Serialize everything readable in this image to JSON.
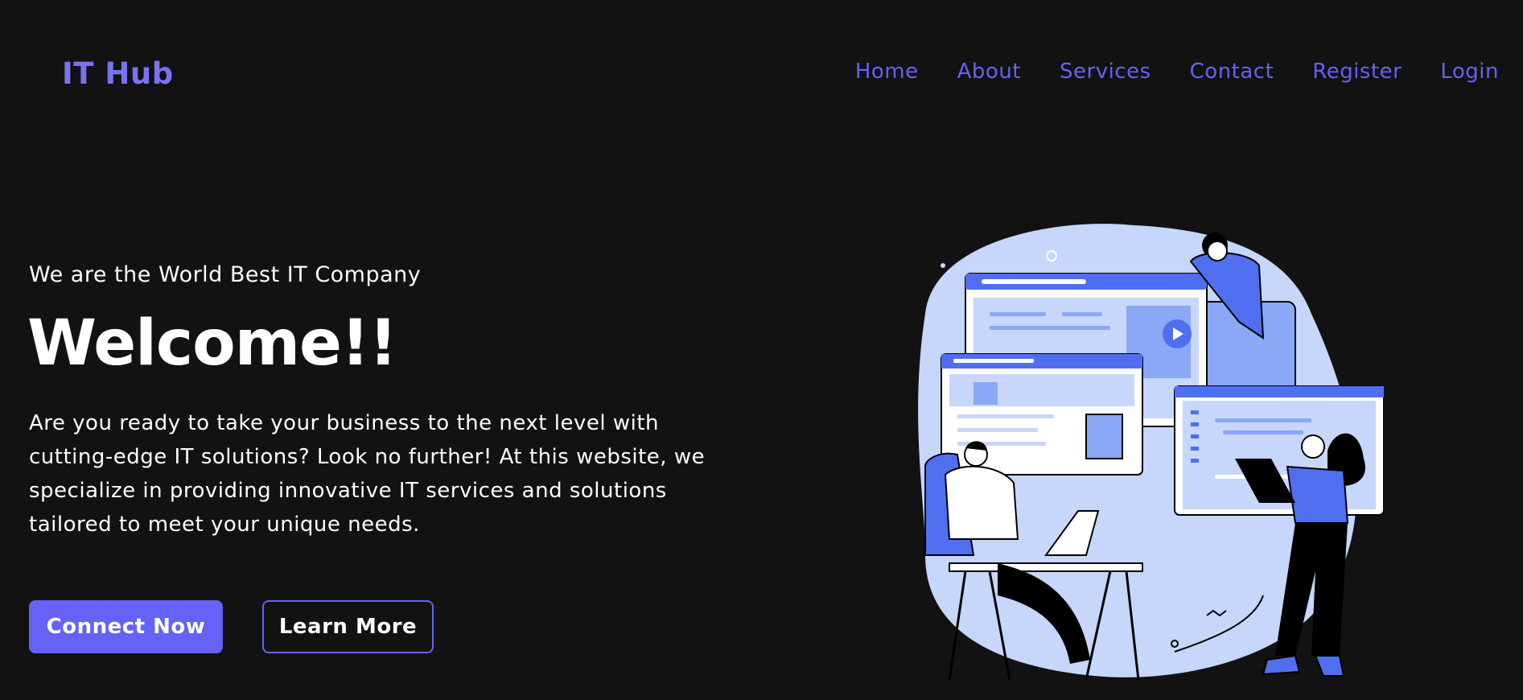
{
  "brand": {
    "name": "IT Hub"
  },
  "nav": {
    "items": [
      "Home",
      "About",
      "Services",
      "Contact",
      "Register",
      "Login"
    ]
  },
  "hero": {
    "tagline": "We are the World Best IT Company",
    "headline": "Welcome!!",
    "description": "Are you ready to take your business to the next level with cutting-edge IT solutions? Look no further! At this website, we specialize in providing innovative IT services and solutions tailored to meet your unique needs.",
    "primary_button": "Connect Now",
    "secondary_button": "Learn More"
  },
  "colors": {
    "background": "#121213",
    "accent": "#6562f5",
    "logo": "#7a73ee",
    "illustration_light": "#c7d6fb",
    "illustration_mid": "#8aa8f6",
    "illustration_dark": "#4f6ff0"
  },
  "illustration": {
    "icon": "developers-at-work-illustration"
  }
}
